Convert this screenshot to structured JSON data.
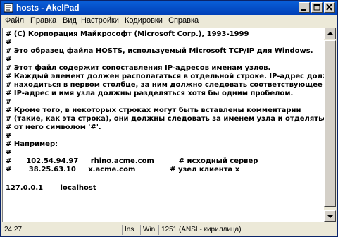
{
  "window": {
    "title": "hosts - AkelPad"
  },
  "menu": [
    "Файл",
    "Правка",
    "Вид",
    "Настройки",
    "Кодировки",
    "Справка"
  ],
  "editor": {
    "lines": [
      "# (C) Корпорация Майкрософт (Microsoft Corp.), 1993-1999",
      "#",
      "# Это образец файла HOSTS, используемый Microsoft TCP/IP для Windows.",
      "#",
      "# Этот файл содержит сопоставления IP-адресов именам узлов.",
      "# Каждый элемент должен располагаться в отдельной строке. IP-адрес должен",
      "# находиться в первом столбце, за ним должно следовать соответствующее имя.",
      "# IP-адрес и имя узла должны разделяться хотя бы одним пробелом.",
      "#",
      "# Кроме того, в некоторых строках могут быть вставлены комментарии",
      "# (такие, как эта строка), они должны следовать за именем узла и отделяться",
      "# от него символом '#'.",
      "#",
      "# Например:",
      "#",
      "#      102.54.94.97     rhino.acme.com          # исходный сервер",
      "#       38.25.63.10     x.acme.com              # узел клиента x",
      "",
      "127.0.0.1       localhost"
    ]
  },
  "status": {
    "position": "24:27",
    "insert_mode": "Ins",
    "line_ending": "Win",
    "encoding": "1251  (ANSI - кириллица)"
  }
}
